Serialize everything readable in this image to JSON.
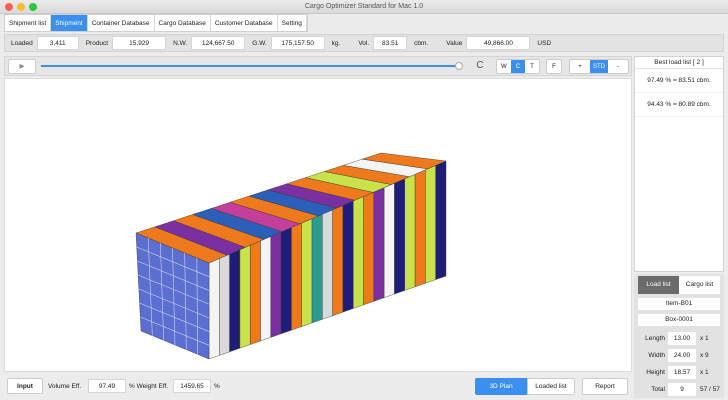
{
  "window": {
    "title": "Cargo Optimizer Standard for Mac 1.0"
  },
  "tabs": [
    "Shipment list",
    "Shipment",
    "Container Database",
    "Cargo Database",
    "Customer Database",
    "Setting"
  ],
  "active_tab": 1,
  "summary": {
    "loaded_label": "Loaded",
    "loaded": "3,411",
    "product_label": "Product",
    "product": "15,929",
    "nw_label": "N.W.",
    "nw": "124,667.50",
    "gw_label": "G.W.",
    "gw": "175,157.50",
    "kg": "kg.",
    "vol_label": "Vol.",
    "vol": "83.51",
    "cbm": "cbm.",
    "value_label": "Value",
    "value": "49,866.00",
    "usd": "USD"
  },
  "controls": {
    "play": "▶",
    "refresh": "C",
    "views": [
      "W",
      "C",
      "T",
      "F"
    ],
    "active_view": "C",
    "zoom": [
      "+",
      "STD",
      "-"
    ],
    "active_zoom": "STD",
    "slider_progress": 1.0
  },
  "best_list": {
    "header": "Best load list [ 2 ]",
    "items": [
      "97.49 % = 83.51 cbm.",
      "94.43 % = 80.89 cbm."
    ]
  },
  "panel": {
    "tab_load": "Load list",
    "tab_cargo": "Cargo list",
    "item": "Item-B01",
    "box": "Box-0001",
    "length_label": "Length",
    "length": "13.00",
    "length_mult": "x 1",
    "width_label": "Width",
    "width": "24.00",
    "width_mult": "x 9",
    "height_label": "Height",
    "height": "18.57",
    "height_mult": "x 1",
    "total_label": "Total",
    "total": "9",
    "count": "57 / 57"
  },
  "footer": {
    "input": "Input",
    "vol_eff_label": "Volume Eff.",
    "vol_eff": "97.49",
    "pct": "%",
    "weight_eff_label": "% Weight Eff.",
    "weight_eff": "1459.65",
    "pct2": "%",
    "plan": "3D Plan",
    "loaded_list": "Loaded list",
    "report": "Report"
  }
}
